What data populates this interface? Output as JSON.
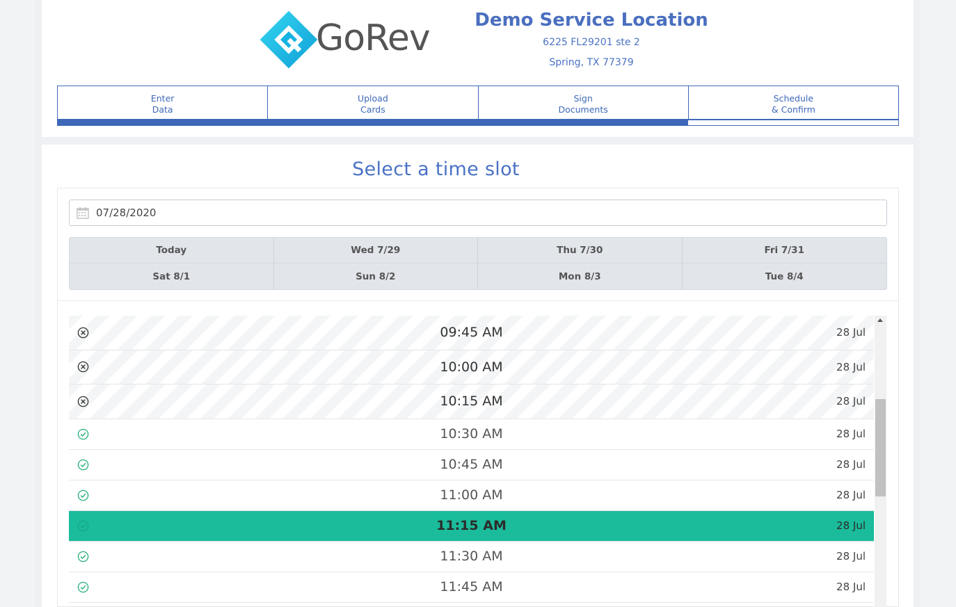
{
  "header": {
    "logo_text": "GoRev",
    "location_name": "Demo Service Location",
    "address_line1": "6225 FL29201 ste 2",
    "address_line2": "Spring, TX 77379"
  },
  "steps": [
    {
      "label": "Enter\nData"
    },
    {
      "label": "Upload\nCards"
    },
    {
      "label": "Sign\nDocuments"
    },
    {
      "label": "Schedule\n& Confirm"
    }
  ],
  "progress": {
    "fraction": 0.75
  },
  "main": {
    "title": "Select a time slot",
    "date_value": "07/28/2020"
  },
  "days": [
    "Today",
    "Wed 7/29",
    "Thu 7/30",
    "Fri 7/31",
    "Sat 8/1",
    "Sun 8/2",
    "Mon 8/3",
    "Tue 8/4"
  ],
  "slots": [
    {
      "time": "09:45 AM",
      "date": "28 Jul",
      "status": "booked"
    },
    {
      "time": "10:00 AM",
      "date": "28 Jul",
      "status": "booked"
    },
    {
      "time": "10:15 AM",
      "date": "28 Jul",
      "status": "booked"
    },
    {
      "time": "10:30 AM",
      "date": "28 Jul",
      "status": "available"
    },
    {
      "time": "10:45 AM",
      "date": "28 Jul",
      "status": "available"
    },
    {
      "time": "11:00 AM",
      "date": "28 Jul",
      "status": "available"
    },
    {
      "time": "11:15 AM",
      "date": "28 Jul",
      "status": "selected"
    },
    {
      "time": "11:30 AM",
      "date": "28 Jul",
      "status": "available"
    },
    {
      "time": "11:45 AM",
      "date": "28 Jul",
      "status": "available"
    }
  ],
  "colors": {
    "brand_blue": "#3d68b8",
    "selected_green": "#1abc9c",
    "available_green": "#2ab27b",
    "logo_cyan": "#1ec8e8"
  },
  "icons": {
    "booked": "circle-x-icon",
    "available": "circle-check-icon",
    "date": "calendar-icon"
  }
}
